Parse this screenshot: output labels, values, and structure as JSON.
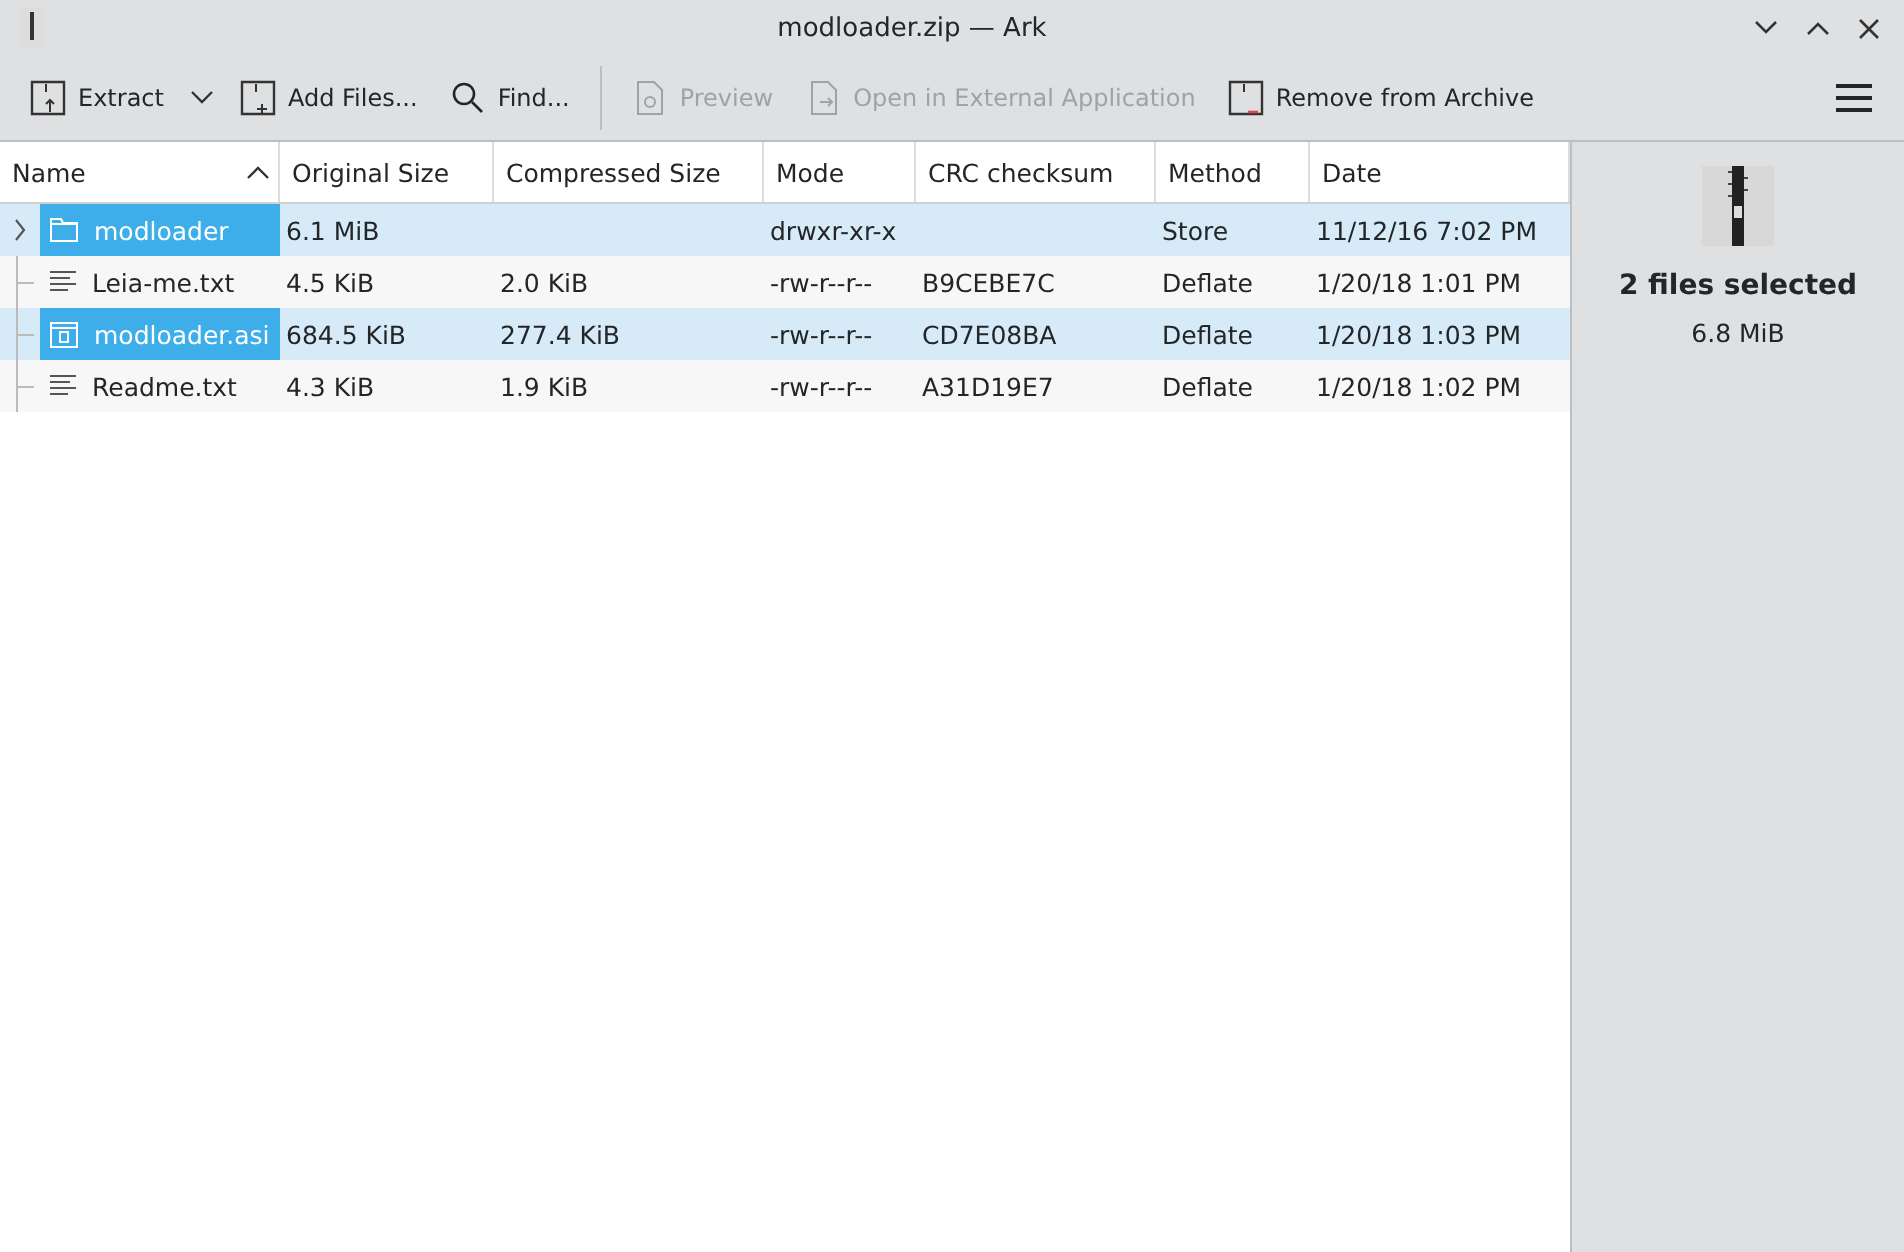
{
  "window": {
    "title": "modloader.zip — Ark"
  },
  "toolbar": [
    {
      "label": "Extract",
      "kind": "extract",
      "disabled": false,
      "dropdown": true
    },
    {
      "label": "Add Files...",
      "kind": "add",
      "disabled": false,
      "dropdown": false
    },
    {
      "label": "Find...",
      "kind": "find",
      "disabled": false,
      "dropdown": false
    },
    {
      "label": "Preview",
      "kind": "preview",
      "disabled": true,
      "dropdown": false
    },
    {
      "label": "Open in External Application",
      "kind": "open",
      "disabled": true,
      "dropdown": false
    },
    {
      "label": "Remove from Archive",
      "kind": "remove",
      "disabled": false,
      "dropdown": false
    }
  ],
  "table": {
    "columns": [
      "Name",
      "Original Size",
      "Compressed Size",
      "Mode",
      "CRC checksum",
      "Method",
      "Date"
    ],
    "rows": [
      {
        "kind": "folder",
        "selected": true,
        "expanded": false,
        "cells": [
          "modloader",
          "6.1 MiB",
          "",
          "drwxr-xr-x",
          "",
          "Store",
          "11/12/16 7:02 PM"
        ]
      },
      {
        "kind": "text",
        "selected": false,
        "cells": [
          "Leia-me.txt",
          "4.5 KiB",
          "2.0 KiB",
          "-rw-r--r--",
          "B9CEBE7C",
          "Deflate",
          "1/20/18 1:01 PM"
        ]
      },
      {
        "kind": "binary",
        "selected": true,
        "cells": [
          "modloader.asi",
          "684.5 KiB",
          "277.4 KiB",
          "-rw-r--r--",
          "CD7E08BA",
          "Deflate",
          "1/20/18 1:03 PM"
        ]
      },
      {
        "kind": "text",
        "selected": false,
        "cells": [
          "Readme.txt",
          "4.3 KiB",
          "1.9 KiB",
          "-rw-r--r--",
          "A31D19E7",
          "Deflate",
          "1/20/18 1:02 PM"
        ]
      }
    ]
  },
  "info_panel": {
    "title": "2 files selected",
    "size": "6.8 MiB"
  }
}
